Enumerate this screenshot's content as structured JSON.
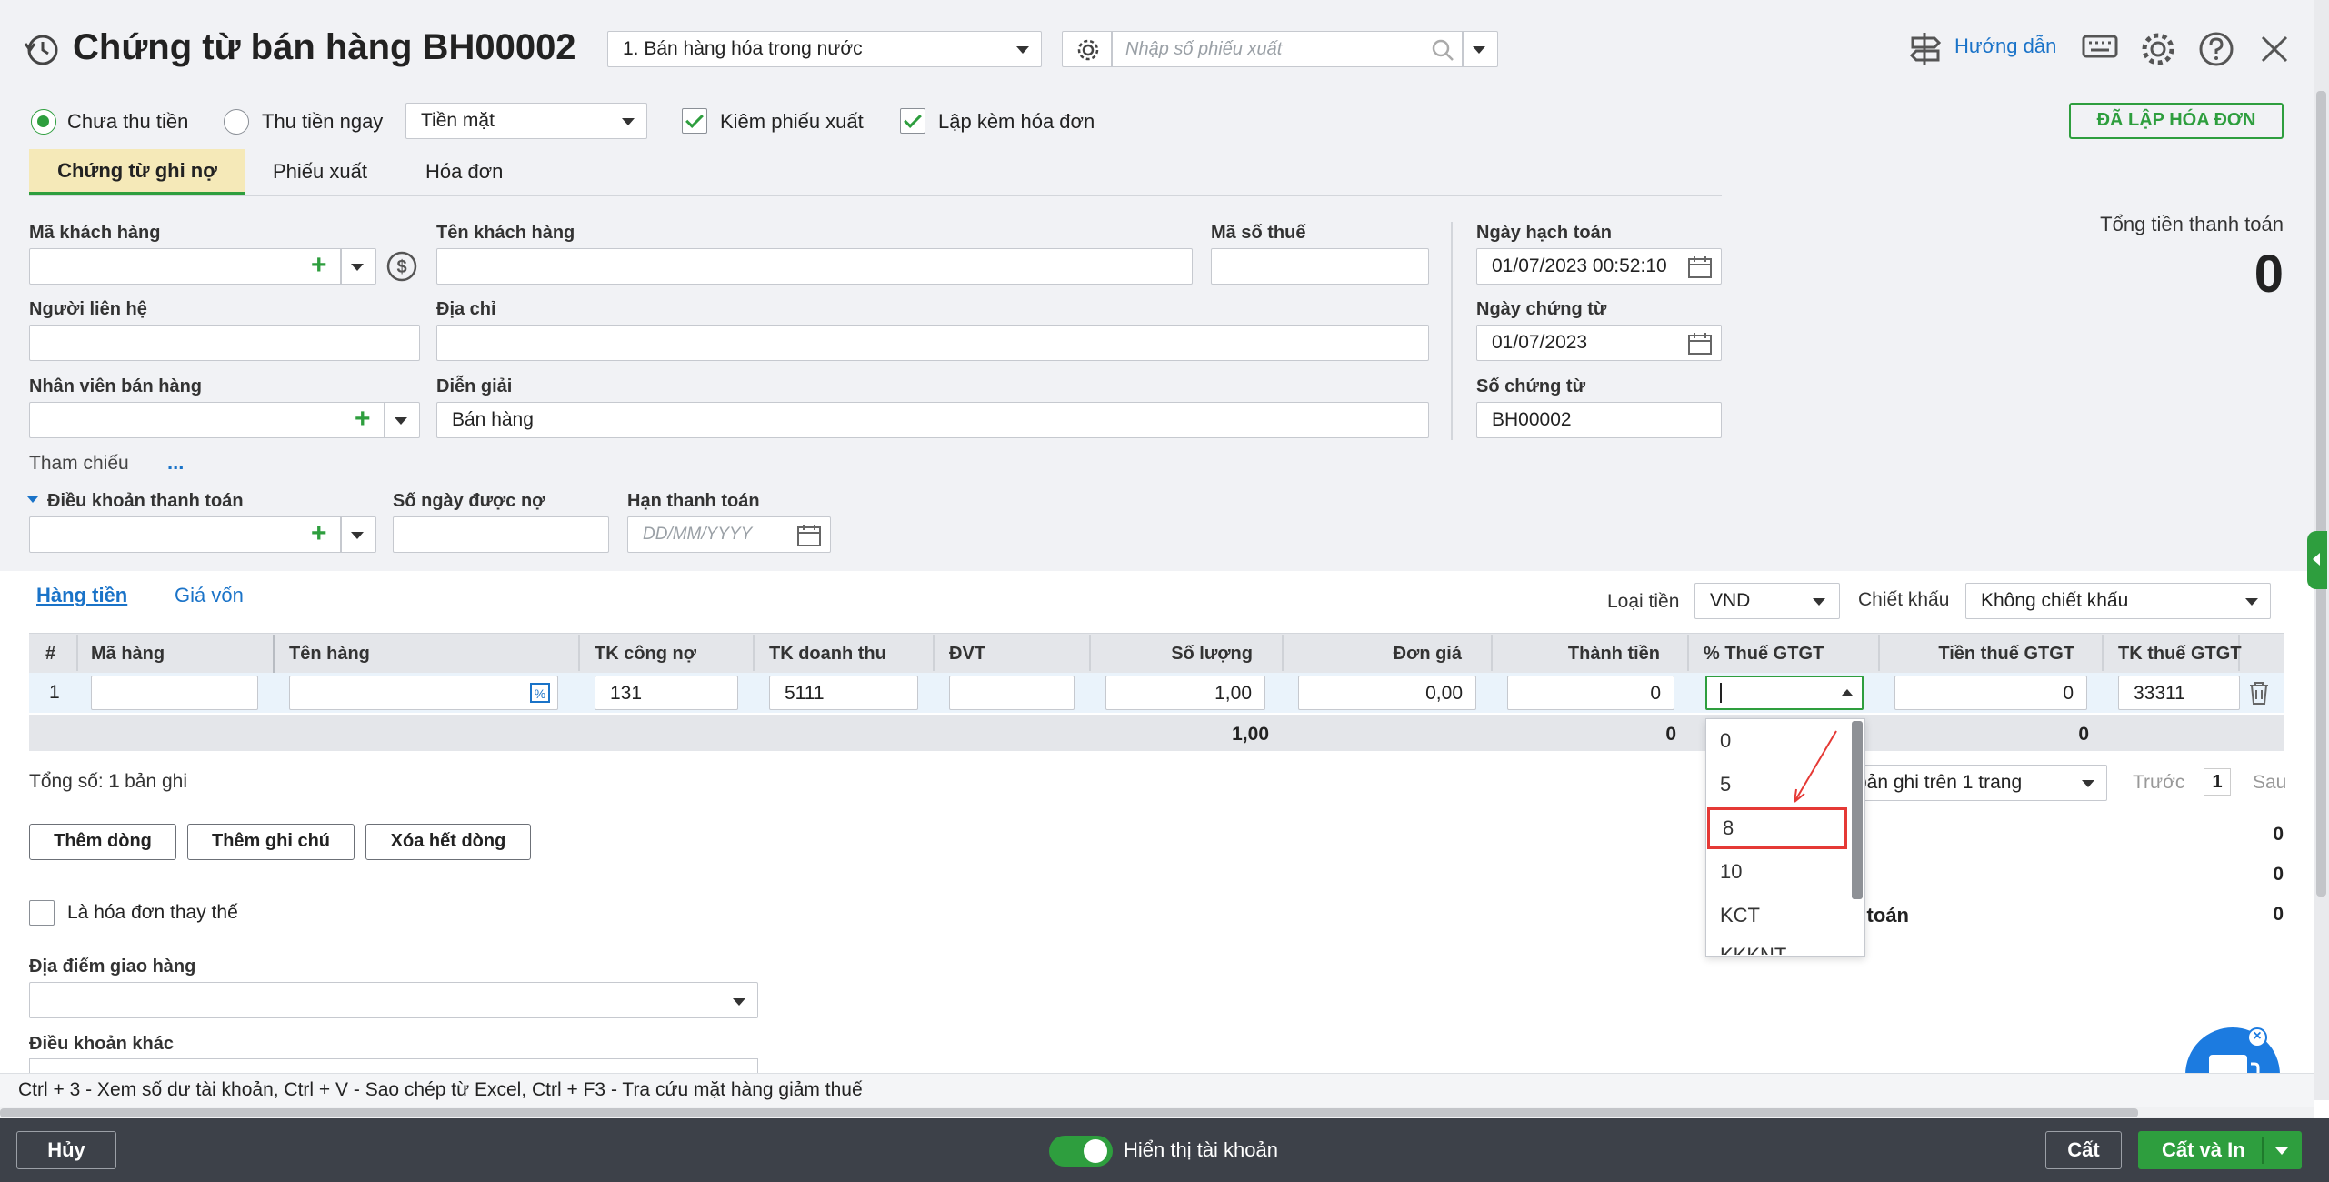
{
  "header": {
    "title": "Chứng từ bán hàng BH00002",
    "sale_type": "1. Bán hàng hóa trong nước",
    "voucher_search_placeholder": "Nhập số phiếu xuất",
    "help_label": "Hướng dẫn"
  },
  "options": {
    "unpaid_label": "Chưa thu tiền",
    "paid_label": "Thu tiền ngay",
    "payment_method": "Tiền mặt",
    "export_slip_label": "Kiêm phiếu xuất",
    "invoice_label": "Lập kèm hóa đơn",
    "invoiced_button": "ĐÃ LẬP HÓA ĐƠN"
  },
  "tabs": [
    "Chứng từ ghi nợ",
    "Phiếu xuất",
    "Hóa đơn"
  ],
  "form": {
    "customer_code_label": "Mã khách hàng",
    "customer_name_label": "Tên khách hàng",
    "tax_code_label": "Mã số thuế",
    "contact_label": "Người liên hệ",
    "address_label": "Địa chỉ",
    "salesperson_label": "Nhân viên bán hàng",
    "description_label": "Diễn giải",
    "description_value": "Bán hàng",
    "reference_label": "Tham chiếu",
    "reference_more": "...",
    "payment_terms_label": "Điều khoản thanh toán",
    "credit_days_label": "Số ngày được nợ",
    "due_date_label": "Hạn thanh toán",
    "due_date_placeholder": "DD/MM/YYYY",
    "posting_date_label": "Ngày hạch toán",
    "posting_date_value": "01/07/2023 00:52:10",
    "voucher_date_label": "Ngày chứng từ",
    "voucher_date_value": "01/07/2023",
    "voucher_no_label": "Số chứng từ",
    "voucher_no_value": "BH00002",
    "total_label": "Tổng tiền thanh toán",
    "total_value": "0"
  },
  "detail": {
    "tab_goods": "Hàng tiền",
    "tab_cost": "Giá vốn",
    "currency_label": "Loại tiền",
    "currency_value": "VND",
    "discount_label": "Chiết khấu",
    "discount_value": "Không chiết khấu",
    "columns": [
      "#",
      "Mã hàng",
      "Tên hàng",
      "TK công nợ",
      "TK doanh thu",
      "ĐVT",
      "Số lượng",
      "Đơn giá",
      "Thành tiền",
      "% Thuế GTGT",
      "Tiền thuế GTGT",
      "TK thuế GTGT"
    ],
    "row": {
      "no": "1",
      "debt_account": "131",
      "revenue_account": "5111",
      "quantity": "1,00",
      "unit_price": "0,00",
      "amount": "0",
      "vat_amount": "0",
      "vat_account": "33311"
    },
    "totals": {
      "quantity": "1,00",
      "amount": "0",
      "vat_amount": "0"
    },
    "record_count_prefix": "Tổng số:",
    "record_count": "1",
    "record_count_suffix": "bản ghi",
    "pager_partial": "bản ghi trên 1 trang",
    "pager_prev": "Trước",
    "pager_page": "1",
    "pager_next": "Sau",
    "vat_options": [
      "0",
      "5",
      "8",
      "10",
      "KCT",
      "KKKNT"
    ],
    "vat_selected_highlight": "8"
  },
  "actions": {
    "add_row": "Thêm dòng",
    "add_note": "Thêm ghi chú",
    "delete_all": "Xóa hết dòng"
  },
  "summary": {
    "v1": "0",
    "v2": "0",
    "v3_label_partial": "n toán",
    "v3": "0"
  },
  "bottom_form": {
    "replacement_invoice_label": "Là hóa đơn thay thế",
    "delivery_place_label": "Địa điểm giao hàng",
    "other_terms_label": "Điều khoản khác"
  },
  "hint": "Ctrl + 3 - Xem số dư tài khoản, Ctrl + V - Sao chép từ Excel, Ctrl + F3 - Tra cứu mặt hàng giảm thuế",
  "footer": {
    "cancel": "Hủy",
    "show_account_label": "Hiển thị tài khoản",
    "save": "Cất",
    "save_print": "Cất và In"
  },
  "colors": {
    "accent": "#2e9e3e",
    "link": "#1a73c8",
    "footer_bg": "#3d4149",
    "highlight": "#e53935"
  }
}
